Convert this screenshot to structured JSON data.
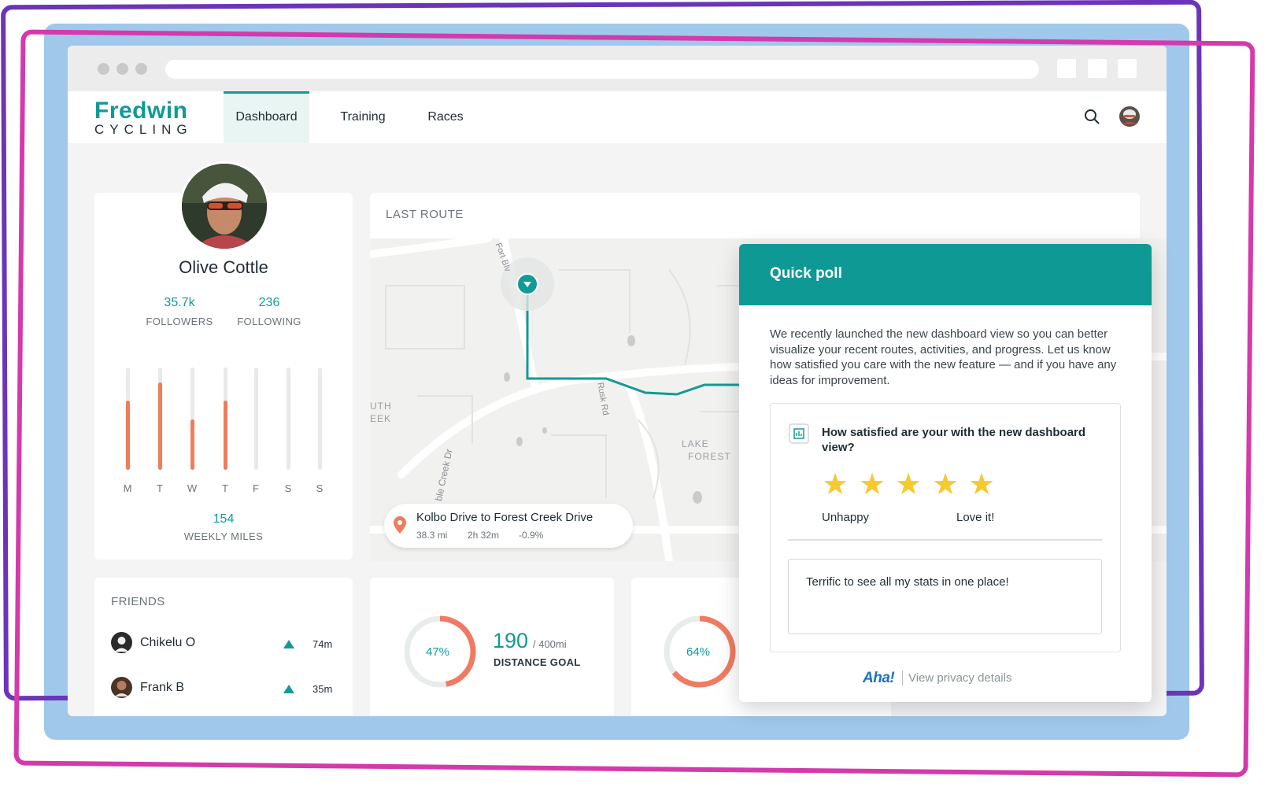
{
  "brand": {
    "name": "Fredwin",
    "sub": "CYCLING",
    "accent": "#129a96",
    "highlight": "#ef7d5b"
  },
  "nav": {
    "tabs": [
      {
        "label": "Dashboard",
        "active": true
      },
      {
        "label": "Training"
      },
      {
        "label": "Races"
      }
    ]
  },
  "icons": {
    "search": "search-icon",
    "avatar": "user-avatar"
  },
  "profile": {
    "name": "Olive Cottle",
    "followers_value": "35.7k",
    "followers_label": "FOLLOWERS",
    "following_value": "236",
    "following_label": "FOLLOWING",
    "weekly_miles_value": "154",
    "weekly_miles_label": "WEEKLY MILES",
    "days": [
      {
        "label": "M",
        "level": 0.68
      },
      {
        "label": "T",
        "level": 0.85
      },
      {
        "label": "W",
        "level": 0.49
      },
      {
        "label": "T",
        "level": 0.68
      },
      {
        "label": "F",
        "level": 0
      },
      {
        "label": "S",
        "level": 0
      },
      {
        "label": "S",
        "level": 0
      }
    ]
  },
  "last_route": {
    "title": "LAST ROUTE",
    "route_name": "Kolbo Drive to Forest Creek Drive",
    "distance": "38.3 mi",
    "duration": "2h 32m",
    "elevation": "-0.9%",
    "map_labels": {
      "fort": "Fort Blv",
      "rusk": "Rusk Rd",
      "creek": "ble Creek Dr",
      "lake1": "LAKE",
      "lake2": "FOREST",
      "south1": "UTH",
      "south2": "EEK"
    }
  },
  "friends": {
    "title": "FRIENDS",
    "items": [
      {
        "name": "Chikelu O",
        "time": "74m"
      },
      {
        "name": "Frank B",
        "time": "35m"
      }
    ]
  },
  "stats": [
    {
      "percent_label": "47%",
      "percent": 0.47,
      "value": "190",
      "unit": "/ 400mi",
      "label": "DISTANCE GOAL"
    },
    {
      "percent_label": "64%",
      "percent": 0.64
    }
  ],
  "poll": {
    "title": "Quick poll",
    "description": "We recently launched the new dashboard view so you can better visualize your recent routes, activities, and progress. Let us know how satisfied you care with the new feature — and if you have any ideas for improvement.",
    "question": "How satisfied are your with the new dashboard view?",
    "rating": 5,
    "rating_max": 5,
    "low_label": "Unhappy",
    "high_label": "Love it!",
    "answer_text": "Terrific to see all my stats in one place!",
    "footer_brand": "Aha!",
    "footer_link": "View privacy details"
  }
}
